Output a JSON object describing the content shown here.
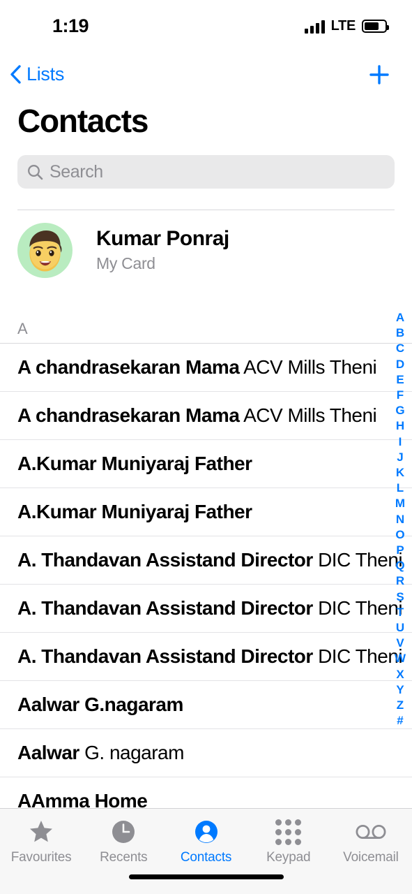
{
  "status_bar": {
    "time": "1:19",
    "carrier_tech": "LTE",
    "signal_icon": "signal-bars-icon",
    "battery_icon": "battery-icon",
    "battery_level_pct": 72
  },
  "nav": {
    "back_label": "Lists",
    "back_icon": "chevron-left-icon",
    "add_icon": "plus-icon"
  },
  "header": {
    "title": "Contacts"
  },
  "search": {
    "placeholder": "Search",
    "value": "",
    "icon": "search-icon"
  },
  "my_card": {
    "name": "Kumar Ponraj",
    "subtitle": "My Card",
    "avatar_icon": "memoji-avatar",
    "avatar_bg": "#b9ecc0"
  },
  "section": {
    "label": "A"
  },
  "contacts": [
    {
      "bold": "A chandrasekaran Mama",
      "rest": " ACV Mills Theni"
    },
    {
      "bold": "A chandrasekaran Mama",
      "rest": " ACV Mills Theni"
    },
    {
      "bold": "A.Kumar Muniyaraj Father",
      "rest": ""
    },
    {
      "bold": "A.Kumar Muniyaraj Father",
      "rest": ""
    },
    {
      "bold": "A. Thandavan Assistand Director",
      "rest": " DIC Theni"
    },
    {
      "bold": "A. Thandavan Assistand Director",
      "rest": " DIC Theni"
    },
    {
      "bold": "A. Thandavan Assistand Director",
      "rest": " DIC Theni"
    },
    {
      "bold": "Aalwar G.nagaram",
      "rest": ""
    },
    {
      "bold": "Aalwar",
      "rest": " G. nagaram"
    },
    {
      "bold": "AAmma Home",
      "rest": ""
    }
  ],
  "index_bar": [
    "A",
    "B",
    "C",
    "D",
    "E",
    "F",
    "G",
    "H",
    "I",
    "J",
    "K",
    "L",
    "M",
    "N",
    "O",
    "P",
    "Q",
    "R",
    "S",
    "T",
    "U",
    "V",
    "W",
    "X",
    "Y",
    "Z",
    "#"
  ],
  "tab_bar": {
    "active_index": 2,
    "accent_color": "#007aff",
    "inactive_color": "#8e8e93",
    "items": [
      {
        "label": "Favourites",
        "icon": "star-icon"
      },
      {
        "label": "Recents",
        "icon": "clock-icon"
      },
      {
        "label": "Contacts",
        "icon": "person-circle-icon"
      },
      {
        "label": "Keypad",
        "icon": "keypad-grid-icon"
      },
      {
        "label": "Voicemail",
        "icon": "voicemail-icon"
      }
    ]
  }
}
